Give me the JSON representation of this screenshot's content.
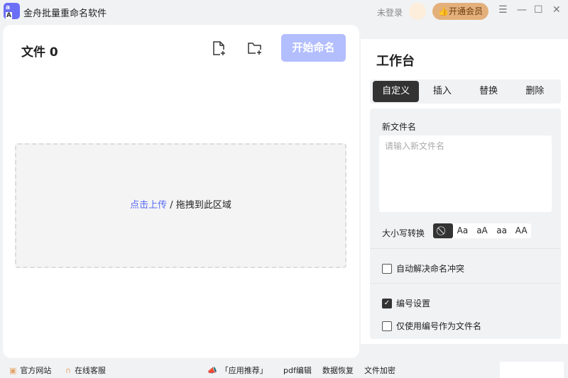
{
  "app": {
    "logo_top": "a",
    "logo_bottom": "A",
    "title": "金舟批量重命名软件",
    "login": "未登录",
    "vip": "开通会员"
  },
  "left": {
    "file_label": "文件 0",
    "start": "开始命名",
    "upload_link": "点击上传",
    "drop_text": " / 拖拽到此区域"
  },
  "right": {
    "title": "工作台",
    "tabs": [
      "自定义",
      "插入",
      "替换",
      "删除"
    ],
    "new_name_label": "新文件名",
    "new_name_placeholder": "请输入新文件名",
    "new_name_value": "",
    "case_label": "大小写转换",
    "case_options": [
      "Aa",
      "aA",
      "aa",
      "AA"
    ],
    "auto_resolve": {
      "label": "自动解决命名冲突",
      "checked": false
    },
    "numbering": {
      "label": "编号设置",
      "checked": true
    },
    "only_number": {
      "label": "仅使用编号作为文件名",
      "checked": false
    }
  },
  "footer": {
    "website": "官方网站",
    "service": "在线客服",
    "recommend": "「应用推荐」",
    "links": [
      "pdf编辑",
      "数据恢复",
      "文件加密"
    ]
  }
}
